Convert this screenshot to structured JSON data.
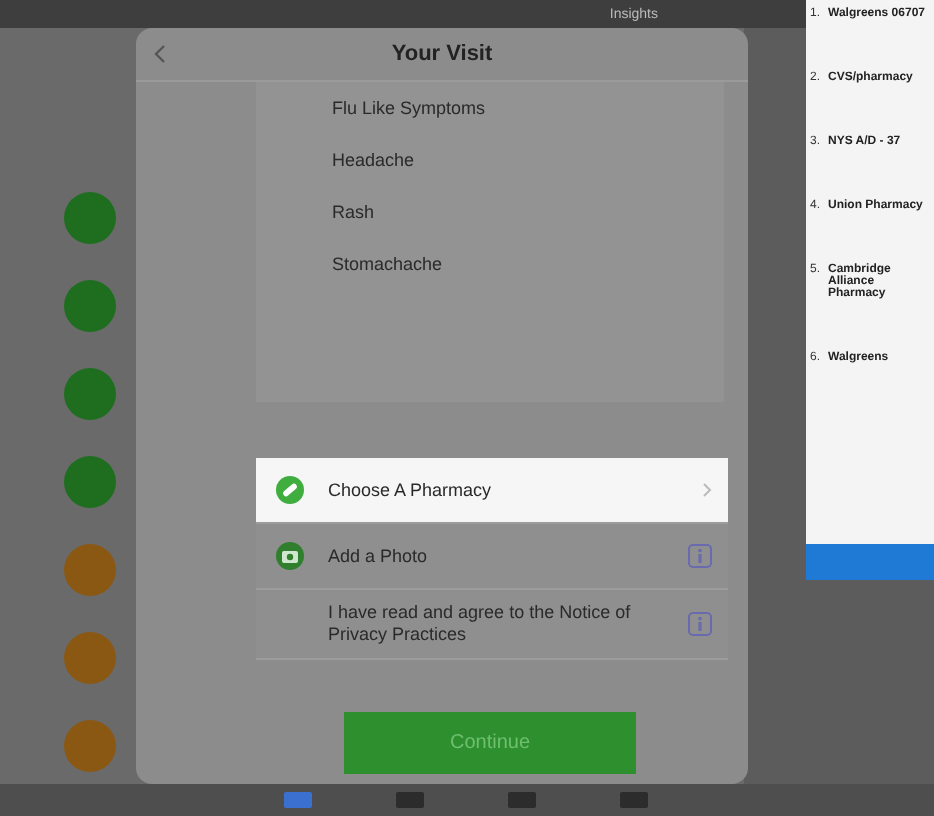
{
  "top_bar": {
    "label": "Insights"
  },
  "status_list": [
    {
      "color": "#1f6e1f"
    },
    {
      "color": "#1f6e1f"
    },
    {
      "color": "#1f6e1f"
    },
    {
      "color": "#1f6e1f"
    },
    {
      "color": "#8a5812"
    },
    {
      "color": "#8a5812"
    },
    {
      "color": "#8a5812"
    }
  ],
  "dialog": {
    "title": "Your Visit",
    "symptoms": [
      "Flu Like Symptoms",
      "Headache",
      "Rash",
      "Stomachache"
    ],
    "options": [
      {
        "kind": "pharmacy",
        "label": "Choose A Pharmacy",
        "selected": true
      },
      {
        "kind": "photo",
        "label": "Add a Photo",
        "selected": false
      },
      {
        "kind": "consent",
        "label": "I have read and agree to the Notice of Privacy Practices",
        "selected": false
      }
    ],
    "continue_button": "Continue"
  },
  "pharmacy_list": [
    {
      "number": "1.",
      "name": "Walgreens 06707"
    },
    {
      "number": "2.",
      "name": "CVS/pharmacy"
    },
    {
      "number": "3.",
      "name": "NYS A/D - 37"
    },
    {
      "number": "4.",
      "name": "Union Pharmacy"
    },
    {
      "number": "5.",
      "name": "Cambridge Alliance Pharmacy"
    },
    {
      "number": "6.",
      "name": "Walgreens"
    }
  ],
  "tab_bar": [
    {
      "selected": true
    },
    {
      "selected": false
    },
    {
      "selected": false
    },
    {
      "selected": false
    }
  ]
}
